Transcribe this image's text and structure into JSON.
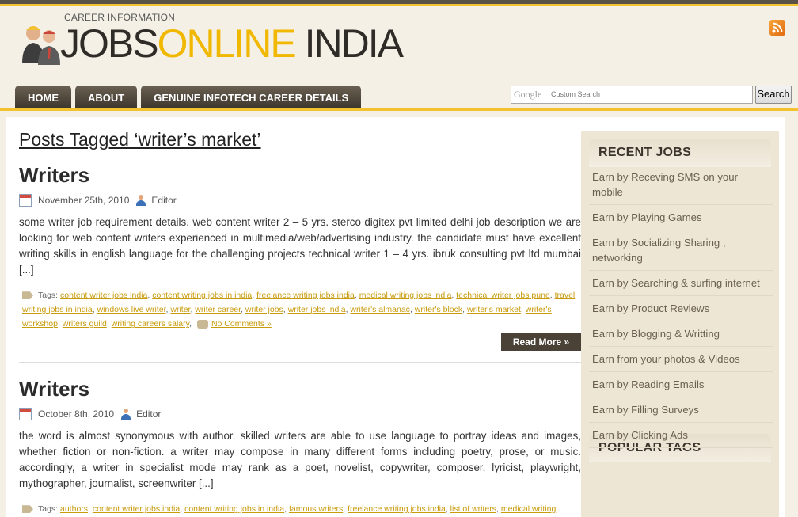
{
  "header": {
    "tagline": "CAREER INFORMATION",
    "logo_part1": "JOBS",
    "logo_part2": "ONLINE",
    "logo_part3": " INDIA",
    "rss_icon": "rss-icon"
  },
  "nav": {
    "items": [
      "HOME",
      "ABOUT",
      "GENUINE INFOTECH CAREER DETAILS"
    ]
  },
  "search": {
    "google_label": "Google",
    "placeholder": "Custom Search",
    "button_label": "Search"
  },
  "page": {
    "title": "Posts Tagged ‘writer’s market’"
  },
  "posts": [
    {
      "title": "Writers",
      "date": "November 25th, 2010",
      "author": "Editor",
      "excerpt": "some writer job requirement details. web content writer  2 – 5 yrs. sterco digitex pvt limited   delhi job description we are looking for web content writers experienced in multimedia/web/advertising industry. the candidate must have excellent writing skills in english language for the challenging projects technical writer  1 – 4 yrs. ibruk consulting pvt ltd  mumbai [...]",
      "tags_label": "Tags:",
      "tags": [
        "content writer jobs india",
        "content writing jobs in india",
        "freelance writing jobs india",
        "medical writing jobs india",
        "technical writer jobs pune",
        "travel writing jobs in india",
        "windows live writer",
        "writer",
        "writer career",
        "writer jobs",
        "writer jobs india",
        "writer's almanac",
        "writer's block",
        "writer's market",
        "writer's workshop",
        "writers guild",
        "writing careers salary"
      ],
      "comments": "No Comments »",
      "read_more": "Read More »"
    },
    {
      "title": "Writers",
      "date": "October 8th, 2010",
      "author": "Editor",
      "excerpt": "the word is almost synonymous with author. skilled writers are able to use language to portray ideas and images, whether fiction or non-fiction. a writer may compose in many different forms including  poetry, prose, or music. accordingly, a writer in specialist mode may rank as a poet, novelist, copywriter, composer, lyricist, playwright, mythographer, journalist, screenwriter [...]",
      "tags_label": "Tags:",
      "tags": [
        "authors",
        "content writer jobs india",
        "content writing jobs in india",
        "famous writers",
        "freelance writing jobs india",
        "list of writers",
        "medical writing"
      ]
    }
  ],
  "sidebar": {
    "recent_jobs_title": "RECENT JOBS",
    "recent_jobs": [
      "Earn by Receving SMS on your mobile",
      "Earn by Playing Games",
      "Earn by Socializing Sharing , networking",
      "Earn by Searching & surfing internet",
      "Earn by Product Reviews",
      "Earn by Blogging & Writting",
      "Earn from your photos & Videos",
      "Earn by Reading Emails",
      "Earn by Filling Surveys",
      "Earn by Clicking Ads"
    ],
    "popular_tags_title": "POPULAR TAGS"
  }
}
